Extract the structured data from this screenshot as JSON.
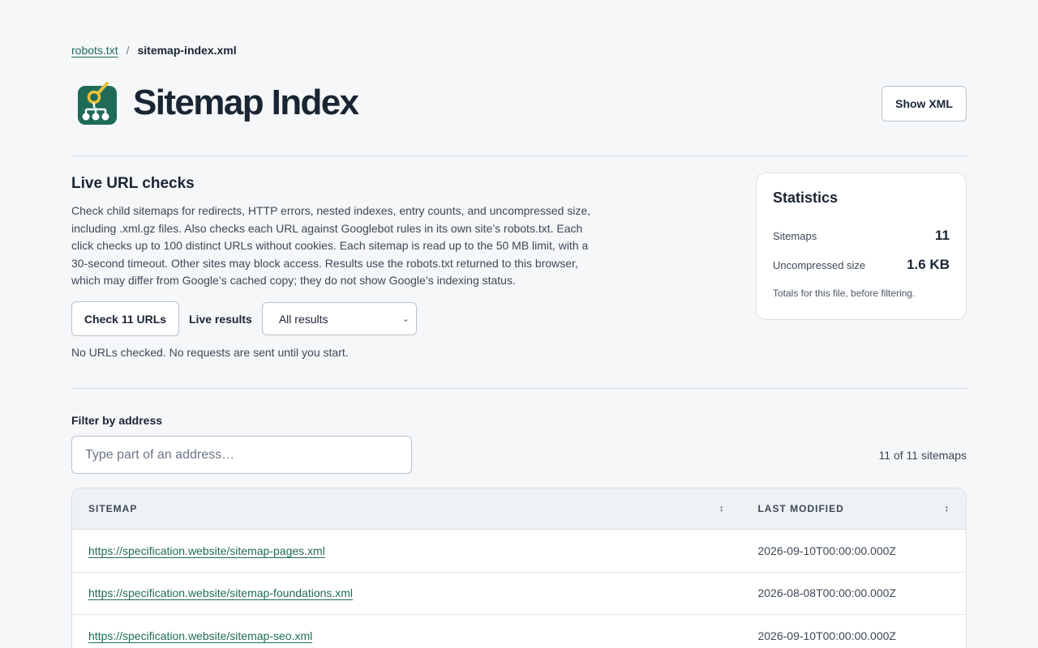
{
  "breadcrumb": {
    "parent": "robots.txt",
    "separator": "/",
    "current": "sitemap-index.xml"
  },
  "header": {
    "title": "Sitemap Index",
    "show_xml_label": "Show XML",
    "logo_icon": "sitemap-logo-icon"
  },
  "live_checks": {
    "heading": "Live URL checks",
    "description": "Check child sitemaps for redirects, HTTP errors, nested indexes, entry counts, and uncompressed size, including .xml.gz files. Also checks each URL against Googlebot rules in its own site’s robots.txt. Each click checks up to 100 distinct URLs without cookies. Each sitemap is read up to the 50 MB limit, with a 30-second timeout. Other sites may block access. Results use the robots.txt returned to this browser, which may differ from Google’s cached copy; they do not show Google’s indexing status.",
    "check_button": "Check 11 URLs",
    "live_results_label": "Live results",
    "filter_select_value": "All results",
    "status": "No URLs checked. No requests are sent until you start."
  },
  "statistics": {
    "heading": "Statistics",
    "rows": [
      {
        "label": "Sitemaps",
        "value": "11"
      },
      {
        "label": "Uncompressed size",
        "value": "1.6 KB"
      }
    ],
    "note": "Totals for this file, before filtering."
  },
  "filter": {
    "label": "Filter by address",
    "placeholder": "Type part of an address…",
    "count": "11 of 11 sitemaps"
  },
  "table": {
    "columns": [
      "SITEMAP",
      "LAST MODIFIED"
    ],
    "rows": [
      {
        "url": "https://specification.website/sitemap-pages.xml",
        "lastmod": "2026-09-10T00:00:00.000Z"
      },
      {
        "url": "https://specification.website/sitemap-foundations.xml",
        "lastmod": "2026-08-08T00:00:00.000Z"
      },
      {
        "url": "https://specification.website/sitemap-seo.xml",
        "lastmod": "2026-09-10T00:00:00.000Z"
      }
    ]
  },
  "colors": {
    "accent": "#1f6b57",
    "logo_bg": "#1f6b57",
    "logo_accent": "#e8c23a",
    "text": "#1a2533",
    "background": "#f5f7f9"
  }
}
